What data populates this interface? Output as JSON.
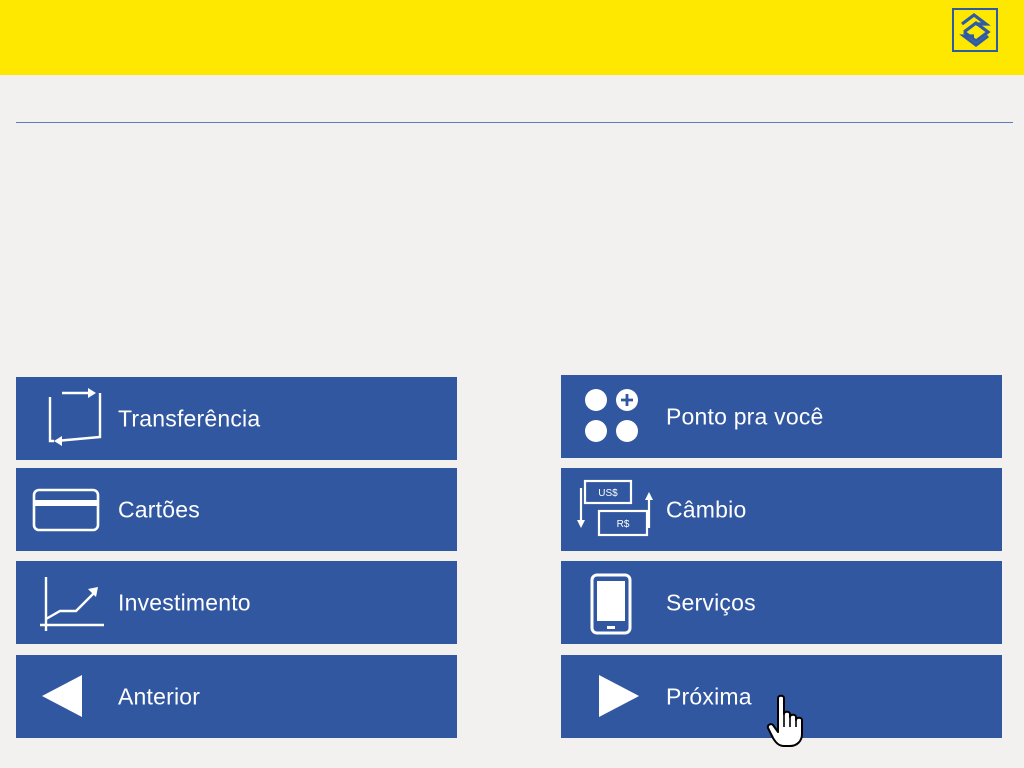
{
  "brand": {
    "logo_icon": "bb-logo-icon",
    "bar_color": "#ffe800",
    "button_color": "#3157a0"
  },
  "menu": {
    "left": [
      {
        "label": "Transferência",
        "icon": "transfer-icon"
      },
      {
        "label": "Cartões",
        "icon": "card-icon"
      },
      {
        "label": "Investimento",
        "icon": "growth-chart-icon"
      },
      {
        "label": "Anterior",
        "icon": "arrow-left-icon"
      }
    ],
    "right": [
      {
        "label": "Ponto pra você",
        "icon": "points-icon"
      },
      {
        "label": "Câmbio",
        "icon": "currency-exchange-icon"
      },
      {
        "label": "Serviços",
        "icon": "mobile-device-icon"
      },
      {
        "label": "Próxima",
        "icon": "arrow-right-icon"
      }
    ]
  },
  "exchange_icon_text": {
    "top": "US$",
    "bottom": "R$"
  }
}
